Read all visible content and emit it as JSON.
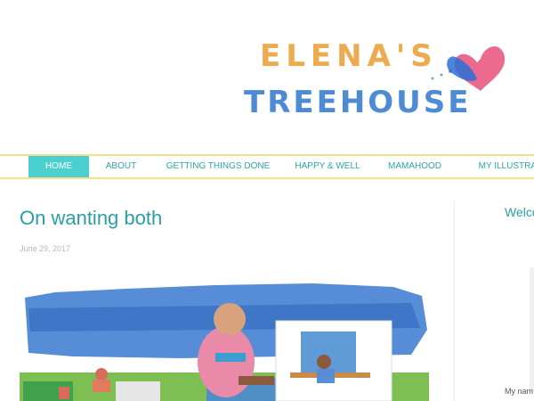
{
  "site": {
    "logo_line1": "ELENA'S",
    "logo_line2": "TREEHOUSE"
  },
  "nav": {
    "items": [
      {
        "label": "HOME",
        "active": true
      },
      {
        "label": "ABOUT"
      },
      {
        "label": "GETTING THINGS DONE"
      },
      {
        "label": "HAPPY & WELL"
      },
      {
        "label": "MAMAHOOD"
      },
      {
        "label": "MY ILLUSTRAT"
      }
    ]
  },
  "post": {
    "title": "On wanting both",
    "date": "June 29, 2017"
  },
  "sidebar": {
    "title": "Welco",
    "text": "My nam"
  },
  "colors": {
    "accent": "#2b9ea3",
    "nav_active_bg": "#4ccfcf",
    "nav_border": "#f3e089",
    "date": "#b9b9b9"
  }
}
